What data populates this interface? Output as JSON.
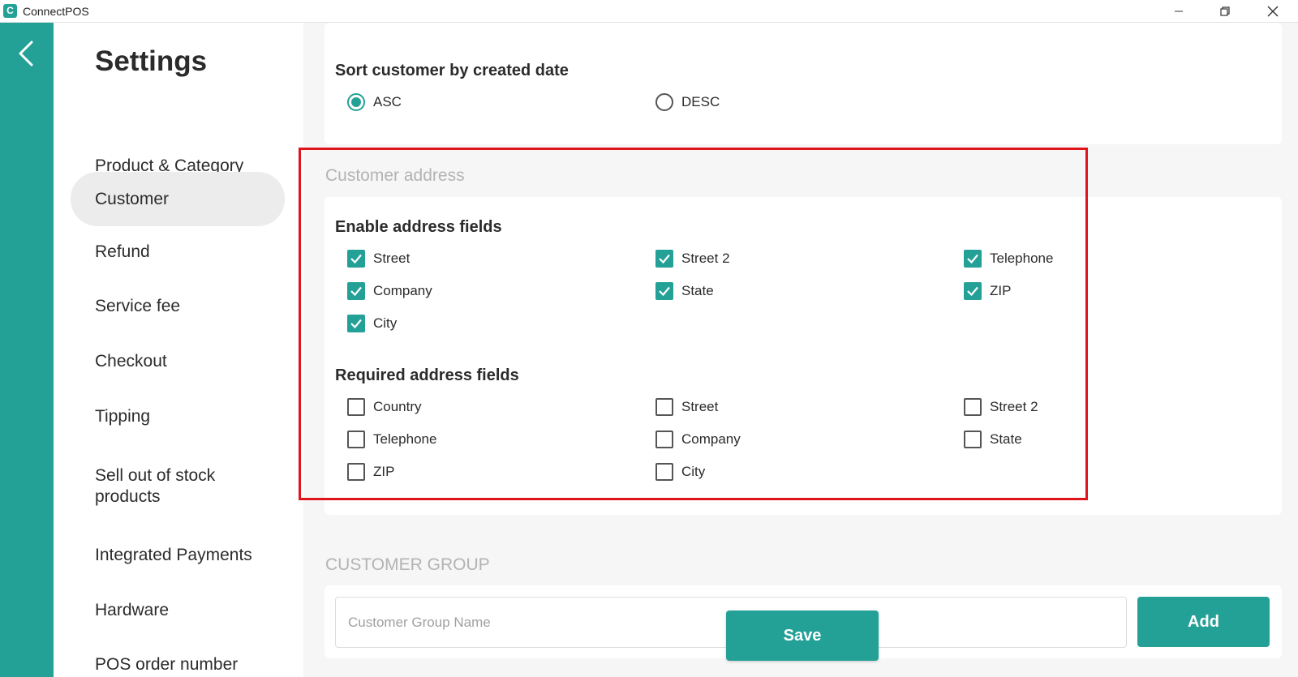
{
  "window": {
    "title": "ConnectPOS",
    "logo_letter": "C"
  },
  "sidebar": {
    "title": "Settings",
    "items": [
      {
        "label": "Product & Category",
        "active": false
      },
      {
        "label": "Customer",
        "active": true
      },
      {
        "label": "Refund",
        "active": false
      },
      {
        "label": "Service fee",
        "active": false
      },
      {
        "label": "Checkout",
        "active": false
      },
      {
        "label": "Tipping",
        "active": false
      },
      {
        "label": "Sell out of stock\nproducts",
        "active": false
      },
      {
        "label": "Integrated Payments",
        "active": false
      },
      {
        "label": "Hardware",
        "active": false
      },
      {
        "label": "POS order number",
        "active": false
      }
    ]
  },
  "sort_section": {
    "heading": "Sort customer by created date",
    "options": [
      {
        "label": "ASC",
        "selected": true
      },
      {
        "label": "DESC",
        "selected": false
      }
    ]
  },
  "customer_address": {
    "title": "Customer address",
    "enable": {
      "heading": "Enable address fields",
      "fields": [
        {
          "label": "Street",
          "checked": true
        },
        {
          "label": "Street 2",
          "checked": true
        },
        {
          "label": "Telephone",
          "checked": true
        },
        {
          "label": "Company",
          "checked": true
        },
        {
          "label": "State",
          "checked": true
        },
        {
          "label": "ZIP",
          "checked": true
        },
        {
          "label": "City",
          "checked": true
        }
      ]
    },
    "required": {
      "heading": "Required address fields",
      "fields": [
        {
          "label": "Country",
          "checked": false
        },
        {
          "label": "Street",
          "checked": false
        },
        {
          "label": "Street 2",
          "checked": false
        },
        {
          "label": "Telephone",
          "checked": false
        },
        {
          "label": "Company",
          "checked": false
        },
        {
          "label": "State",
          "checked": false
        },
        {
          "label": "ZIP",
          "checked": false
        },
        {
          "label": "City",
          "checked": false
        }
      ]
    }
  },
  "customer_group": {
    "title": "CUSTOMER GROUP",
    "input_placeholder": "Customer Group Name",
    "input_value": "",
    "add_label": "Add"
  },
  "save_label": "Save",
  "colors": {
    "accent": "#24a197",
    "highlight": "#e0141b"
  },
  "icons": {
    "back": "chevron-left-icon",
    "check": "check-icon"
  }
}
